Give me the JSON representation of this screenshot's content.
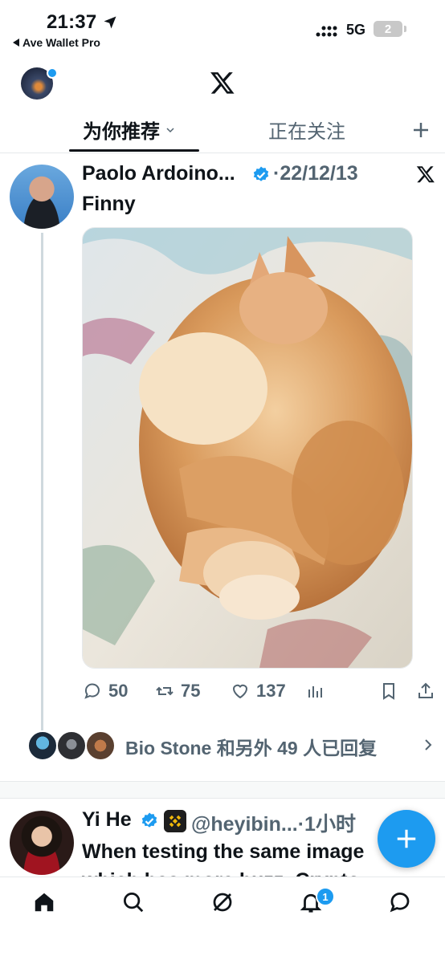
{
  "status_bar": {
    "time": "21:37",
    "back_app": "Ave Wallet Pro",
    "network": "5G",
    "battery": "2"
  },
  "header": {
    "logo": "x-logo-icon"
  },
  "tabs": [
    {
      "label": "为你推荐",
      "active": true
    },
    {
      "label": "正在关注",
      "active": false
    }
  ],
  "tweet1": {
    "name": "Paolo Ardoino...",
    "date": "·22/12/13",
    "text": "Finny",
    "media": "cat-photo",
    "stats": {
      "replies": "50",
      "retweets": "75",
      "likes": "137"
    },
    "replied_by": "Bio Stone 和另外 49 人已回复"
  },
  "tweet2": {
    "name": "Yi He",
    "handle": "@heyibin...",
    "time": "·1小时",
    "text_line1": "When testing the same image",
    "text_line2": "which has more buzz, Crypto"
  },
  "colors": {
    "accent": "#1d9bf0",
    "text": "#0f1419",
    "muted": "#536471"
  },
  "bottom_nav": {
    "items": [
      "home-icon",
      "search-icon",
      "grok-icon",
      "notifications-icon",
      "messages-icon"
    ],
    "notifications_badge": "1"
  }
}
